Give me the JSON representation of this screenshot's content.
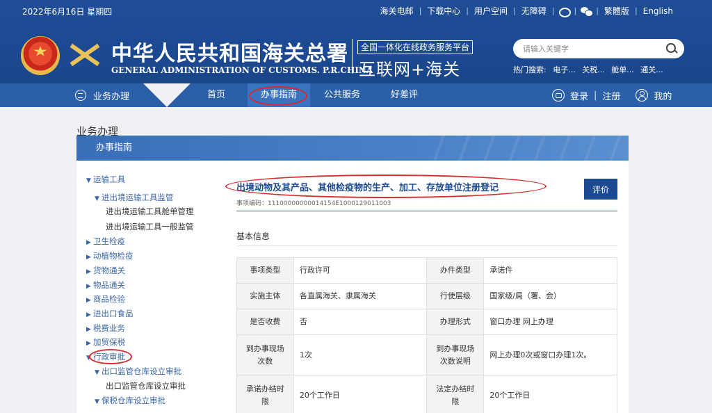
{
  "topbar": {
    "date": "2022年6月16日 星期四",
    "links": [
      "海关电邮",
      "下载中心",
      "用户空间",
      "无障碍"
    ],
    "lang_links": [
      "繁體版",
      "English"
    ]
  },
  "brand": {
    "cn_name": "中华人民共和国海关总署",
    "en_name": "GENERAL ADMINISTRATION OF CUSTOMS. P.R.CHINA",
    "platform_box": "全国一体化在线政务服务平台",
    "platform_main": "互联网+海关"
  },
  "search": {
    "placeholder": "请输入关键字",
    "hot_label": "热门搜索:",
    "hot_terms": [
      "电子...",
      "关税...",
      "舱单...",
      "通关..."
    ]
  },
  "nav": {
    "biz": "业务办理",
    "items": [
      "首页",
      "办事指南",
      "公共服务",
      "好差评"
    ],
    "login": "登录",
    "register": "注册",
    "mine": "我的"
  },
  "section": {
    "title": "业务办理",
    "panel": "办事指南"
  },
  "sidebar": [
    {
      "label": "运输工具",
      "level": 0,
      "arrow": "▼"
    },
    {
      "label": "进出境运输工具监管",
      "level": 1,
      "arrow": "▼"
    },
    {
      "label": "进出境运输工具舱单管理",
      "level": 2,
      "arrow": ""
    },
    {
      "label": "进出境运输工具一般监管",
      "level": 2,
      "arrow": ""
    },
    {
      "label": "卫生检疫",
      "level": 0,
      "arrow": "▶"
    },
    {
      "label": "动植物检疫",
      "level": 0,
      "arrow": "▶"
    },
    {
      "label": "货物通关",
      "level": 0,
      "arrow": "▶"
    },
    {
      "label": "物品通关",
      "level": 0,
      "arrow": "▶"
    },
    {
      "label": "商品检验",
      "level": 0,
      "arrow": "▶"
    },
    {
      "label": "进出口食品",
      "level": 0,
      "arrow": "▶"
    },
    {
      "label": "税费业务",
      "level": 0,
      "arrow": "▶"
    },
    {
      "label": "加贸保税",
      "level": 0,
      "arrow": "▶"
    },
    {
      "label": "行政审批",
      "level": 0,
      "arrow": "▼"
    },
    {
      "label": "出口监管仓库设立审批",
      "level": 1,
      "arrow": "▼"
    },
    {
      "label": "出口监管仓库设立审批",
      "level": 2,
      "arrow": ""
    },
    {
      "label": "保税仓库设立审批",
      "level": 1,
      "arrow": "▼"
    }
  ],
  "item": {
    "title": "出境动物及其产品、其他检疫物的生产、加工、存放单位注册登记",
    "code": "事项编码：11100000000014154E1000129011003",
    "rate_button": "评价",
    "basic_label": "基本信息"
  },
  "table": [
    [
      "事项类型",
      "行政许可",
      "办件类型",
      "承诺件"
    ],
    [
      "实施主体",
      "各直属海关、隶属海关",
      "行使层级",
      "国家级/局（署、会）"
    ],
    [
      "是否收费",
      "否",
      "办理形式",
      "窗口办理 网上办理"
    ],
    [
      "到办事现场次数",
      "1次",
      "到办事现场次数说明",
      "网上办理0次或窗口办理1次。"
    ],
    [
      "承诺办结时限",
      "20个工作日",
      "法定办结时限",
      "20个工作日"
    ]
  ]
}
